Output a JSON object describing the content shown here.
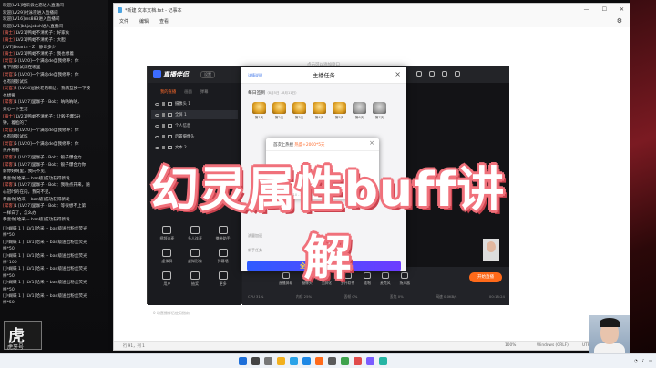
{
  "chat": {
    "lines": [
      {
        "tag": "",
        "text": "欢迎[LV1]哈采云之恋进入直播间"
      },
      {
        "tag": "",
        "text": "欢迎[LV29]射泳宗进入直播间"
      },
      {
        "tag": "",
        "text": "欢迎[LV16]ms883进入直播间"
      },
      {
        "tag": "",
        "text": "欢迎[LV1]bhjajsbxh进入直播间"
      },
      {
        "tag": "[骑士]",
        "text": "[LV21]鸭蛤不清优子：好家伙"
      },
      {
        "tag": "[骑士]",
        "text": "[LV21]鸭蛤不清优子：大胆"
      },
      {
        "tag": "",
        "text": "[LV7]Dearth - Z：静母多少"
      },
      {
        "tag": "[骑士]",
        "text": "[LV21]鸭蛤不清优子：我也想着"
      },
      {
        "tag": "[灵官]",
        "text": "5 [LV20]一个满总de自我修养：你"
      },
      {
        "tag": "",
        "text": "看下随影试炼在哪里"
      },
      {
        "tag": "[灵官]",
        "text": "5 [LV20]一个满总de自我修养：你"
      },
      {
        "tag": "",
        "text": "也有随影试炼"
      },
      {
        "tag": "[灵官]",
        "text": "2 [LV24]战长老的嘶边：我俩互换一下技"
      },
      {
        "tag": "",
        "text": "也想要"
      },
      {
        "tag": "[常客]",
        "text": "1 [LV27]里珈子 - Bob：呐呐呐呐，"
      },
      {
        "tag": "",
        "text": "关心一下生活"
      },
      {
        "tag": "[骑士]",
        "text": "[LV21]鸭蛤不清优子：让骰子爆5分"
      },
      {
        "tag": "",
        "text": "钟，着脸的了"
      },
      {
        "tag": "[灵官]",
        "text": "5 [LV20]一个满总de自我修养：你"
      },
      {
        "tag": "",
        "text": "也有随影试炼"
      },
      {
        "tag": "[灵官]",
        "text": "5 [LV20]一个满总de自我修养：你"
      },
      {
        "tag": "",
        "text": "点开看看"
      },
      {
        "tag": "[常客]",
        "text": "1 [LV27]里珈子 - Bob：骰子爆合力"
      },
      {
        "tag": "[常客]",
        "text": "1 [LV27]里珈子 - Bob：骰子爆合力你"
      },
      {
        "tag": "",
        "text": "影你好啊里，我向不见，"
      },
      {
        "tag": "",
        "text": "恭喜你[哈采 -- ban级]成功获得新发"
      },
      {
        "tag": "[常客]",
        "text": "1 [LV27]里珈子 - Bob：我晚点开来，随"
      },
      {
        "tag": "",
        "text": "心冠叶的在内，我向不见，"
      },
      {
        "tag": "",
        "text": "恭喜你[哈采 -- ban级]成功获得新发"
      },
      {
        "tag": "[常客]",
        "text": "1 [LV27]里珈子 - Bob：等很想不上第"
      },
      {
        "tag": "",
        "text": "一样白了，怎么办"
      },
      {
        "tag": "",
        "text": "恭喜你[哈采 -- ban级]成功获得新发"
      }
    ],
    "gifts": [
      "[小蝴蝶 1 ] [LV1]哈采 -- ban级送出粉丝荧光",
      "棒*50",
      "[小蝴蝶 1 ] [LV1]哈采 -- ban级送出粉丝荧光",
      "棒*50",
      "[小蝴蝶 1 ] [LV1]哈采 -- ban级送出粉丝荧光",
      "棒*100",
      "[小蝴蝶 1 ] [LV1]哈采 -- ban级送出粉丝荧光",
      "棒*50",
      "[小蝴蝶 1 ] [LV1]哈采 -- ban级送出粉丝荧光",
      "棒*50",
      "[小蝴蝶 1 ] [LV1]哈采 -- ban级送出粉丝荧光",
      "棒*50"
    ],
    "logo_big": "虎",
    "logo_sub": "虎牙号"
  },
  "notepad": {
    "title": "*新建 文本文档.txt - 记事本",
    "menu": [
      "文件",
      "编辑",
      "查看"
    ],
    "hint": "点击可以添加窗口",
    "status_pos": "行 91，列 1",
    "status_zoom": "100%",
    "status_crlf": "Windows (CRLF)",
    "status_enc": "UTF-8"
  },
  "stream": {
    "app_name": "直播伴侣",
    "badge": "设置",
    "tabs": [
      "我的直播",
      "画面",
      "弹幕"
    ],
    "sources": [
      "摄像头 1",
      "全屏 1",
      "个人信息",
      "后置摄像头",
      "文本 2"
    ],
    "tools": [
      "视频连麦",
      "多人连麦",
      "携带助手",
      "虚拟屏",
      "虚拟形象",
      "弹幕墙",
      "用户",
      "抽奖",
      "更多"
    ],
    "footer_left": "0 场直播伴侣使用指南",
    "bottom_buttons": [
      "直播屏幕",
      "摄像头",
      "全屏化",
      "多开软件",
      "连唱",
      "麦克风",
      "扬声器"
    ],
    "start_label": "开始直播",
    "stats": [
      "CPU 31%",
      "内存 25%",
      "丢帧 0%",
      "丢包 0%",
      "网速 0.0KB/s",
      "00:18:24"
    ]
  },
  "task_dialog": {
    "link": "详情说明",
    "title": "主播任务",
    "daily": "每日签到",
    "daily_range": "（8月5日 - 8月11日）",
    "rewards": [
      "第1天",
      "第2天",
      "第3天",
      "第4天",
      "第5天",
      "第6天",
      "第7天"
    ],
    "section_a": "流量加速",
    "section_b": "新手任务",
    "banner_text": "全民PK"
  },
  "popup": {
    "title": "首次上热搜",
    "bonus": "热度+2000*5天",
    "date": "2022.04.10 - 2022.05.10"
  },
  "overlay_title": "幻灵属性buff讲解"
}
